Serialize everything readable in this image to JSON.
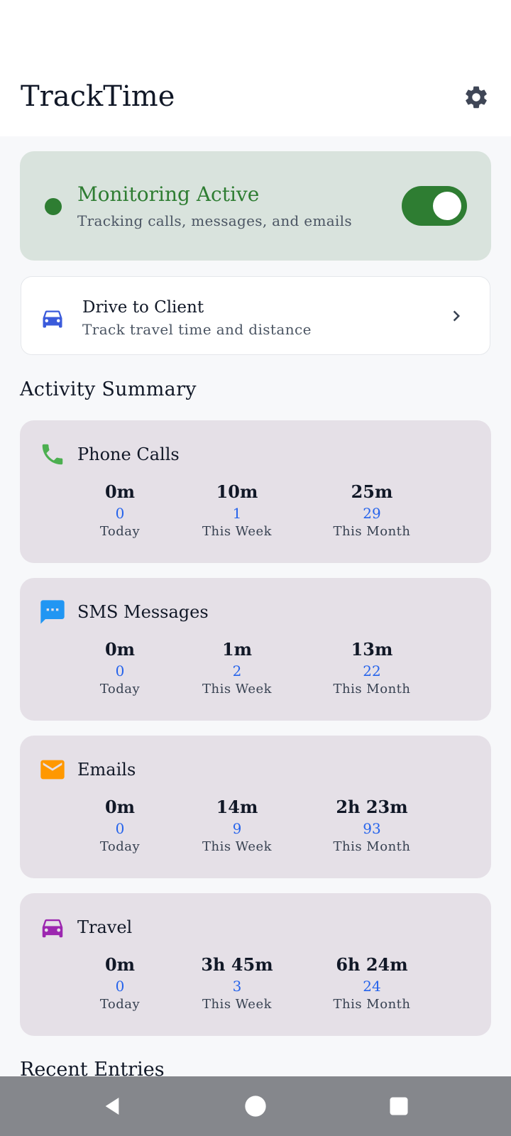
{
  "app": {
    "title": "TrackTime",
    "settings_icon": "gear-icon"
  },
  "monitoring": {
    "title": "Monitoring Active",
    "subtitle": "Tracking calls, messages, and emails",
    "enabled": true,
    "accent": "#2e7d32"
  },
  "drive": {
    "title": "Drive to Client",
    "subtitle": "Track travel time and distance",
    "icon": "car-icon",
    "icon_color": "#3b5bdb"
  },
  "summary": {
    "title": "Activity Summary",
    "cards": [
      {
        "name": "Phone Calls",
        "icon": "phone-icon",
        "icon_color": "#4caf50",
        "stats": [
          {
            "duration": "0m",
            "count": "0",
            "label": "Today"
          },
          {
            "duration": "10m",
            "count": "1",
            "label": "This Week"
          },
          {
            "duration": "25m",
            "count": "29",
            "label": "This Month"
          }
        ]
      },
      {
        "name": "SMS Messages",
        "icon": "message-icon",
        "icon_color": "#2196f3",
        "stats": [
          {
            "duration": "0m",
            "count": "0",
            "label": "Today"
          },
          {
            "duration": "1m",
            "count": "2",
            "label": "This Week"
          },
          {
            "duration": "13m",
            "count": "22",
            "label": "This Month"
          }
        ]
      },
      {
        "name": "Emails",
        "icon": "email-icon",
        "icon_color": "#ff9800",
        "stats": [
          {
            "duration": "0m",
            "count": "0",
            "label": "Today"
          },
          {
            "duration": "14m",
            "count": "9",
            "label": "This Week"
          },
          {
            "duration": "2h 23m",
            "count": "93",
            "label": "This Month"
          }
        ]
      },
      {
        "name": "Travel",
        "icon": "car-icon",
        "icon_color": "#9c27b0",
        "stats": [
          {
            "duration": "0m",
            "count": "0",
            "label": "Today"
          },
          {
            "duration": "3h 45m",
            "count": "3",
            "label": "This Week"
          },
          {
            "duration": "6h 24m",
            "count": "24",
            "label": "This Month"
          }
        ]
      }
    ]
  },
  "recent": {
    "title": "Recent Entries"
  },
  "nav": {
    "back_icon": "back-icon",
    "home_icon": "home-icon",
    "recents_icon": "recents-icon"
  }
}
